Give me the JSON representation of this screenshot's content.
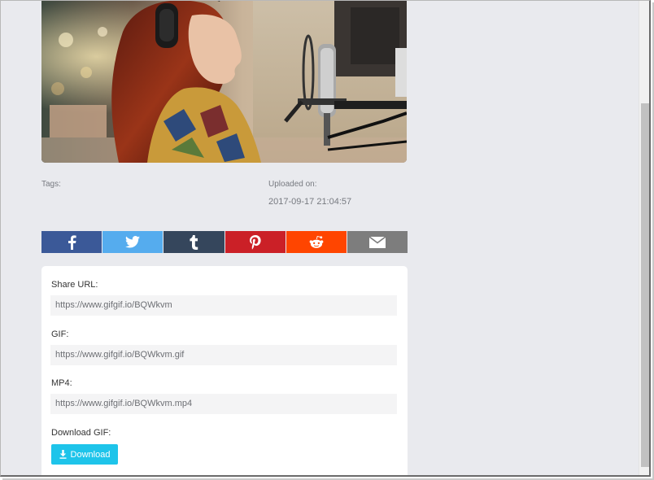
{
  "video": {
    "thumbnail_icon": "video-frame-singer-with-microphone"
  },
  "meta": {
    "tags_label": "Tags:",
    "uploaded_label": "Uploaded on:",
    "uploaded_value": "2017-09-17 21:04:57"
  },
  "share_bar": {
    "buttons": [
      {
        "icon": "facebook-icon",
        "color": "#3b5998"
      },
      {
        "icon": "twitter-icon",
        "color": "#55acee"
      },
      {
        "icon": "tumblr-icon",
        "color": "#35465c"
      },
      {
        "icon": "pinterest-icon",
        "color": "#cb2027"
      },
      {
        "icon": "reddit-icon",
        "color": "#ff4500"
      },
      {
        "icon": "email-icon",
        "color": "#7d7d7d"
      }
    ]
  },
  "links": {
    "share_url_label": "Share URL:",
    "share_url_value": "https://www.gifgif.io/BQWkvm",
    "gif_label": "GIF:",
    "gif_value": "https://www.gifgif.io/BQWkvm.gif",
    "mp4_label": "MP4:",
    "mp4_value": "https://www.gifgif.io/BQWkvm.mp4",
    "download_label": "Download GIF:",
    "download_button": "Download",
    "download_icon": "download-icon"
  },
  "colors": {
    "page_background": "#e9eaee",
    "card_background": "#ffffff",
    "accent": "#1ec4ea"
  }
}
